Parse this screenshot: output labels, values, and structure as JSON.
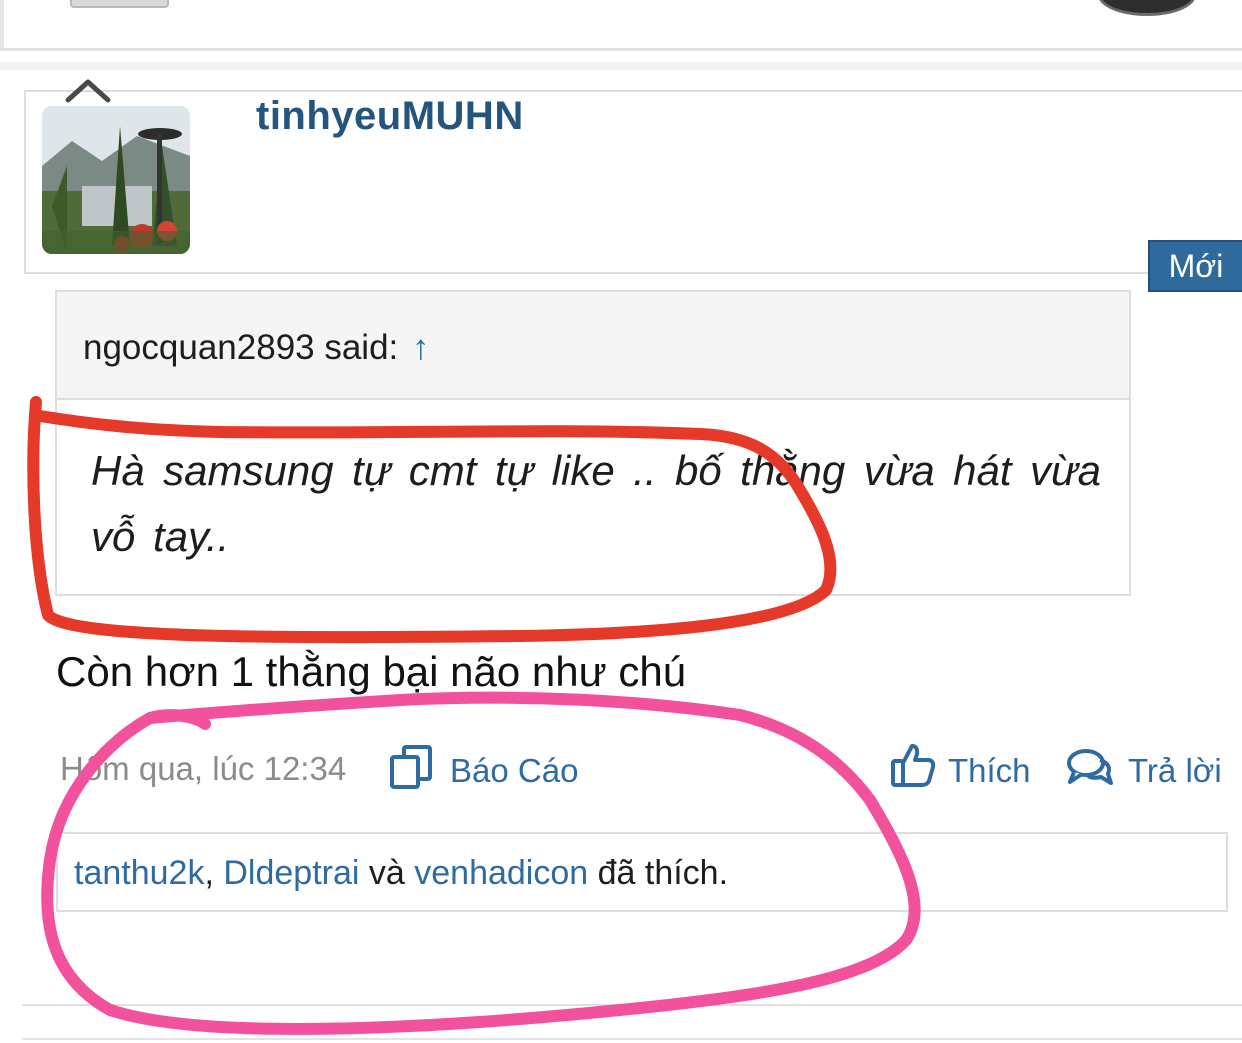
{
  "post": {
    "username": "tinhyeuMUHN",
    "new_badge": "Mới",
    "quote": {
      "author_line": "ngocquan2893 said:",
      "arrow": "↑",
      "text": "Hà samsung tự cmt tự like .. bố thằng vừa hát vừa vỗ tay.."
    },
    "message": "Còn hơn 1 thằng bại não như chú",
    "meta": {
      "date": "Hôm qua, lúc 12:34",
      "report_label": "Báo Cáo",
      "like_label": "Thích",
      "reply_label": "Trả lời"
    },
    "likes": {
      "user1": "tanthu2k",
      "sep1": ", ",
      "user2": "Dldeptrai",
      "sep2": " và ",
      "user3": "venhadicon",
      "suffix": " đã thích."
    }
  },
  "colors": {
    "link": "#2d6ba2",
    "username": "#23557f",
    "badge_bg": "#2f6a9c",
    "annotation_red": "#e53a2a",
    "annotation_pink": "#f2519c"
  },
  "icons": [
    "chevron-up-icon",
    "report-icon",
    "thumbs-up-icon",
    "speech-bubble-icon"
  ]
}
